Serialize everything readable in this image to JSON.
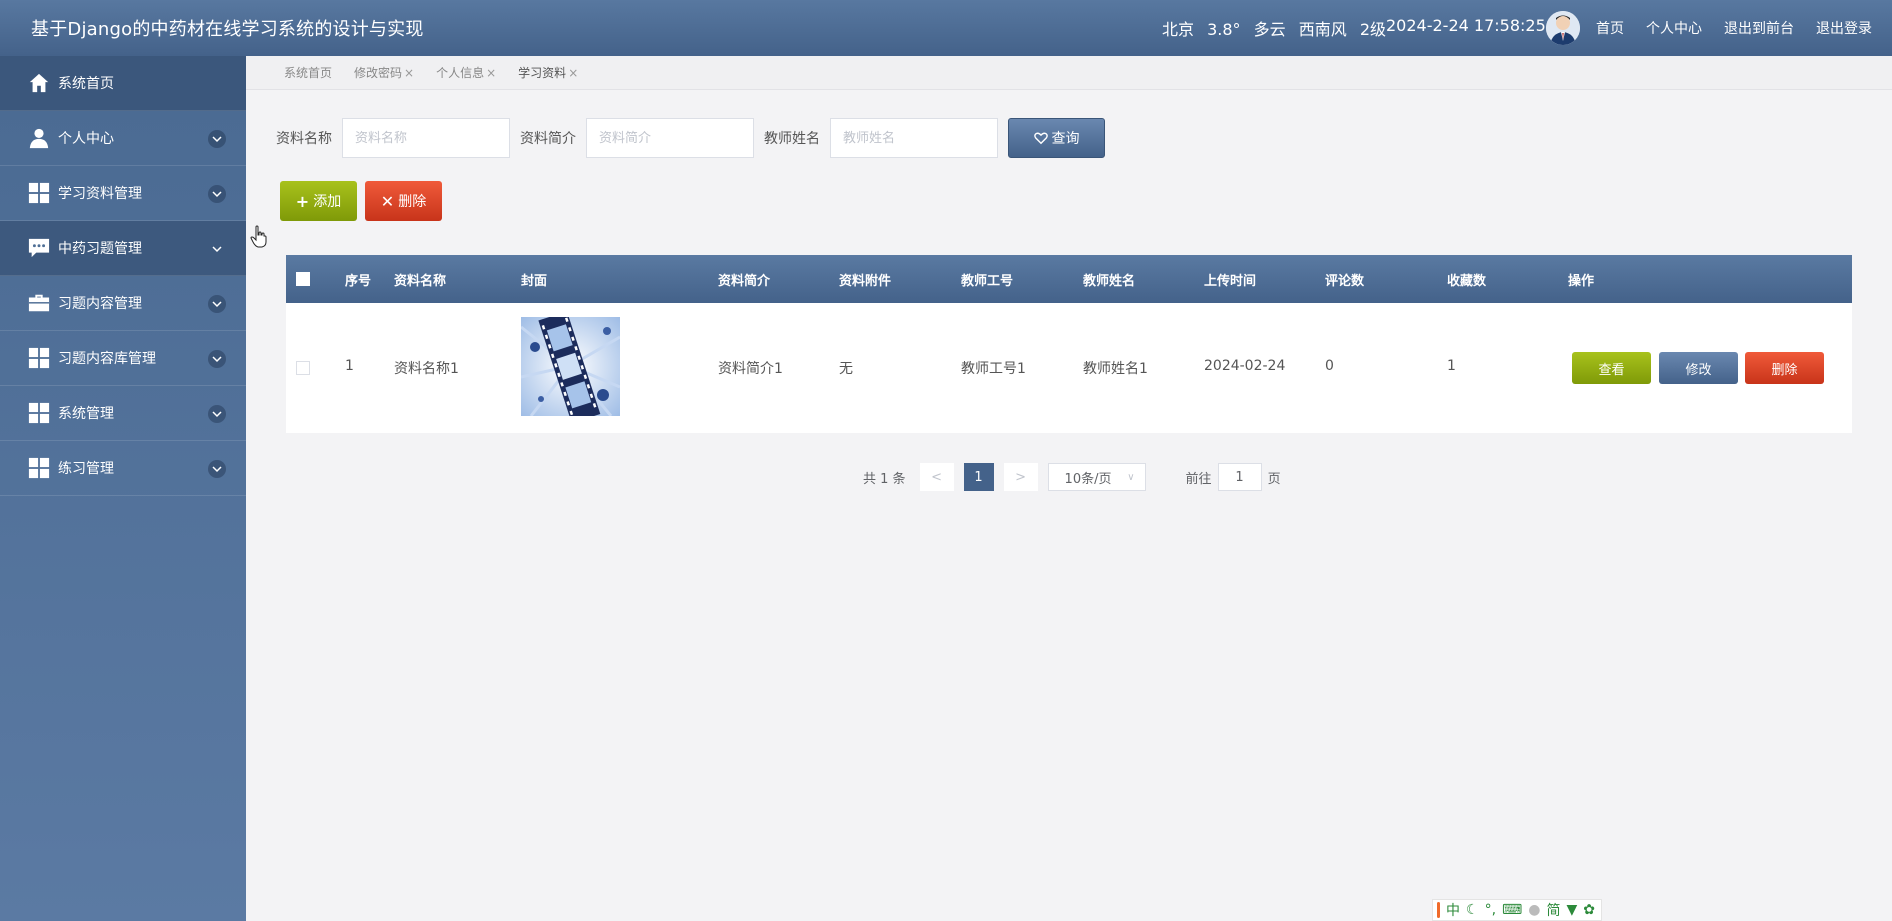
{
  "header": {
    "title": "基于Django的中药材在线学习系统的设计与实现",
    "weather": {
      "city": "北京",
      "temp": "3.8°",
      "condition": "多云",
      "wind": "西南风",
      "level": "2级"
    },
    "datetime": "2024-2-24 17:58:25",
    "nav": [
      "首页",
      "个人中心",
      "退出到前台",
      "退出登录"
    ]
  },
  "sidebar": {
    "items": [
      {
        "label": "系统首页",
        "icon": "home-icon"
      },
      {
        "label": "个人中心",
        "icon": "user-icon"
      },
      {
        "label": "学习资料管理",
        "icon": "grid-icon"
      },
      {
        "label": "中药习题管理",
        "icon": "chat-icon"
      },
      {
        "label": "习题内容管理",
        "icon": "briefcase-icon"
      },
      {
        "label": "习题内容库管理",
        "icon": "grid-icon"
      },
      {
        "label": "系统管理",
        "icon": "grid-icon"
      },
      {
        "label": "练习管理",
        "icon": "grid-icon"
      }
    ]
  },
  "tabs": [
    {
      "label": "系统首页",
      "closable": false
    },
    {
      "label": "修改密码",
      "closable": true
    },
    {
      "label": "个人信息",
      "closable": true
    },
    {
      "label": "学习资料",
      "closable": true
    }
  ],
  "search": {
    "fields": [
      {
        "label": "资料名称",
        "placeholder": "资料名称"
      },
      {
        "label": "资料简介",
        "placeholder": "资料简介"
      },
      {
        "label": "教师姓名",
        "placeholder": "教师姓名"
      }
    ],
    "query_label": "查询"
  },
  "actions": {
    "add_label": "添加",
    "delete_label": "删除"
  },
  "table": {
    "headers": [
      "序号",
      "资料名称",
      "封面",
      "资料简介",
      "资料附件",
      "教师工号",
      "教师姓名",
      "上传时间",
      "评论数",
      "收藏数",
      "操作"
    ],
    "rows": [
      {
        "index": "1",
        "name": "资料名称1",
        "cover": "film-reel-image",
        "intro": "资料简介1",
        "attachment": "无",
        "teacher_id": "教师工号1",
        "teacher_name": "教师姓名1",
        "upload_time": "2024-02-24",
        "comments": "0",
        "favorites": "1",
        "ops": {
          "view": "查看",
          "edit": "修改",
          "delete": "删除"
        }
      }
    ]
  },
  "pagination": {
    "total_text": "共 1 条",
    "prev": "<",
    "current": "1",
    "next": ">",
    "page_size": "10条/页",
    "goto_prefix": "前往",
    "goto_value": "1",
    "goto_suffix": "页"
  },
  "ime": {
    "items": [
      "中",
      "简"
    ]
  },
  "colors": {
    "primary": "#44628a",
    "success": "#8aa612",
    "danger": "#e04a2a"
  }
}
